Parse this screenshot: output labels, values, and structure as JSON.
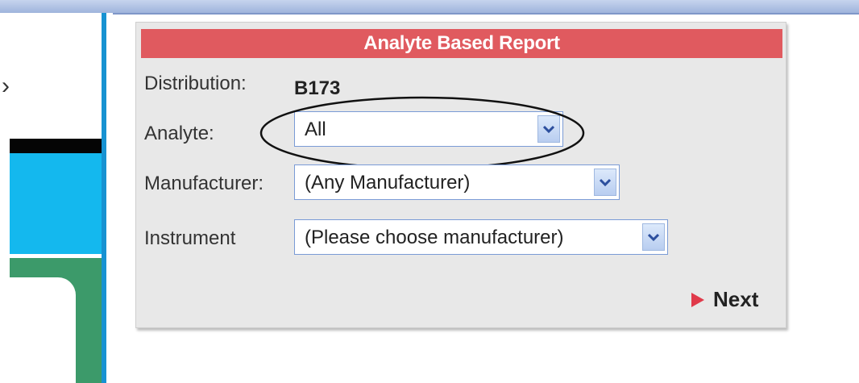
{
  "panel": {
    "title": "Analyte Based Report",
    "distribution_label": "Distribution:",
    "distribution_value": "B173",
    "analyte_label": "Analyte:",
    "analyte_value": "All",
    "manufacturer_label": "Manufacturer:",
    "manufacturer_value": "(Any Manufacturer)",
    "instrument_label": "Instrument",
    "instrument_value": "(Please choose manufacturer)",
    "next_label": "Next"
  },
  "icons": {
    "dropdown": "chevron-down-icon",
    "next": "play-arrow-icon"
  },
  "colors": {
    "header": "#e05a5f",
    "accent_blue": "#14b8ee",
    "accent_green": "#3c9a6a"
  }
}
